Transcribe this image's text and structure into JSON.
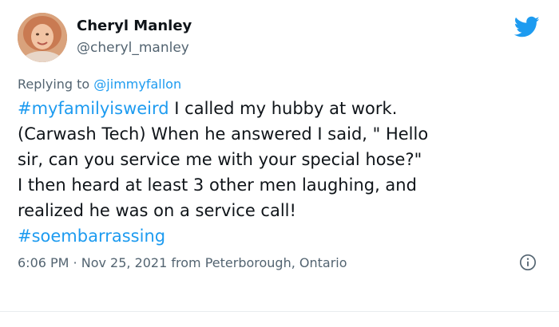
{
  "author": {
    "display_name": "Cheryl Manley",
    "handle": "@cheryl_manley",
    "avatar_icon": "profile-photo"
  },
  "reply_context": {
    "prefix": "Replying to ",
    "mention": "@jimmyfallon"
  },
  "tweet": {
    "line1_hashtag": "#myfamilyisweird",
    "line1_text": " I called my hubby at work.",
    "line2": "(Carwash Tech) When he answered I said, \" Hello",
    "line3": "sir, can you service me with your special hose?\"",
    "line4": "I then heard at least 3 other men laughing, and",
    "line5": "realized he was on a service call!",
    "line6_hashtag": "#soembarrassing"
  },
  "meta": {
    "timestamp": "6:06 PM · Nov 25, 2021 from Peterborough, Ontario"
  },
  "icons": {
    "brand": "twitter-bird-icon",
    "info": "info-icon"
  },
  "colors": {
    "accent": "#1d9bf0",
    "secondary_text": "#536471",
    "primary_text": "#0f1419"
  }
}
